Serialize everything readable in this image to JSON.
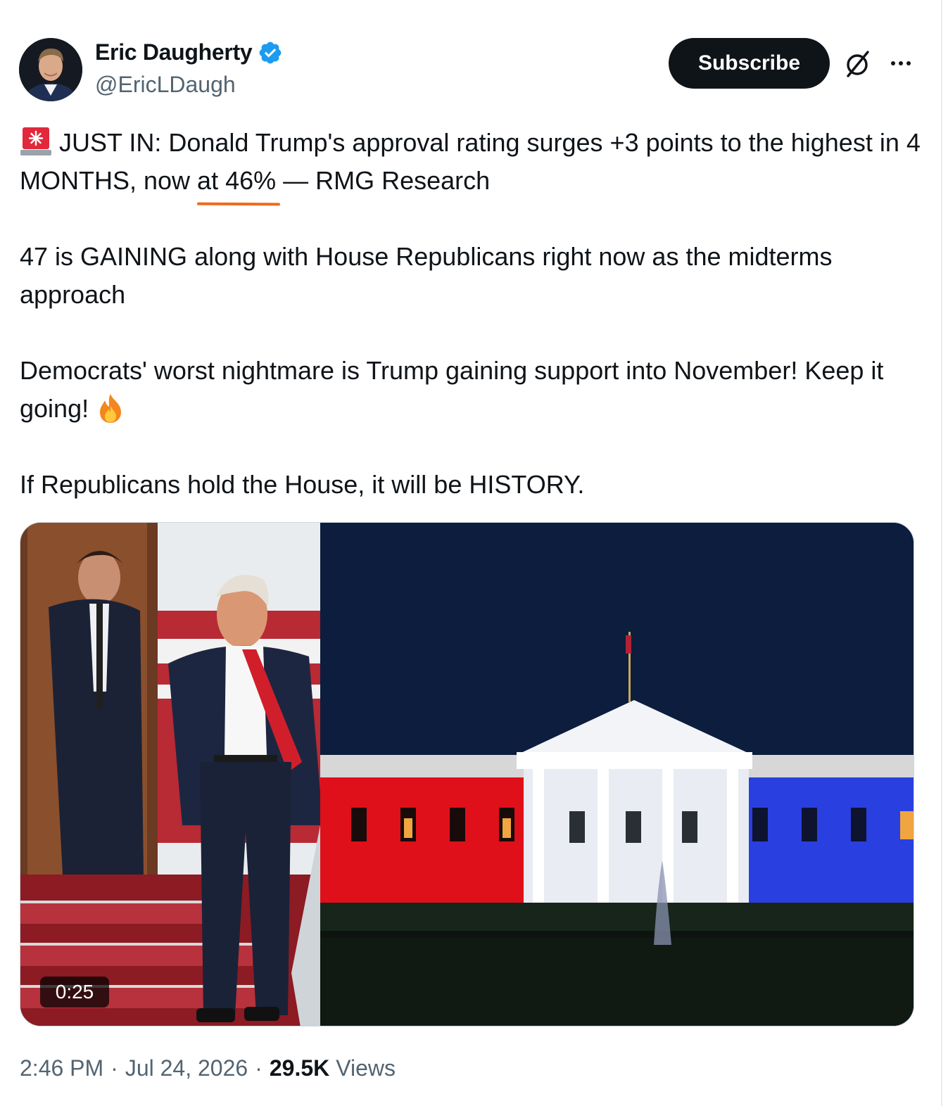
{
  "author": {
    "display_name": "Eric Daugherty",
    "handle": "@EricLDaugh",
    "verified": true,
    "avatar_icon": "profile-photo"
  },
  "actions": {
    "subscribe_label": "Subscribe",
    "grok_icon": "slashed-circle-icon",
    "more_icon": "more-dots-icon"
  },
  "tweet": {
    "p1_part1": "JUST IN: Donald Trump's approval rating surges +3 points to the highest in 4 MONTHS, now ",
    "p1_highlight": "at 46%",
    "p1_part2": " — RMG Research",
    "p2": "47 is GAINING along with House Republicans right now as the midterms approach",
    "p3": "Democrats' worst nightmare is Trump gaining support into November! Keep it going!",
    "p4": "If Republicans hold the House, it will be HISTORY.",
    "emoji_siren": "police-light-emoji",
    "emoji_fire": "fire-emoji",
    "annotation_color": "#f06a1a"
  },
  "media": {
    "type": "video",
    "duration": "0:25"
  },
  "footer": {
    "time": "2:46 PM",
    "separator": "·",
    "date": "Jul 24, 2026",
    "views_count": "29.5K",
    "views_label": "Views"
  }
}
